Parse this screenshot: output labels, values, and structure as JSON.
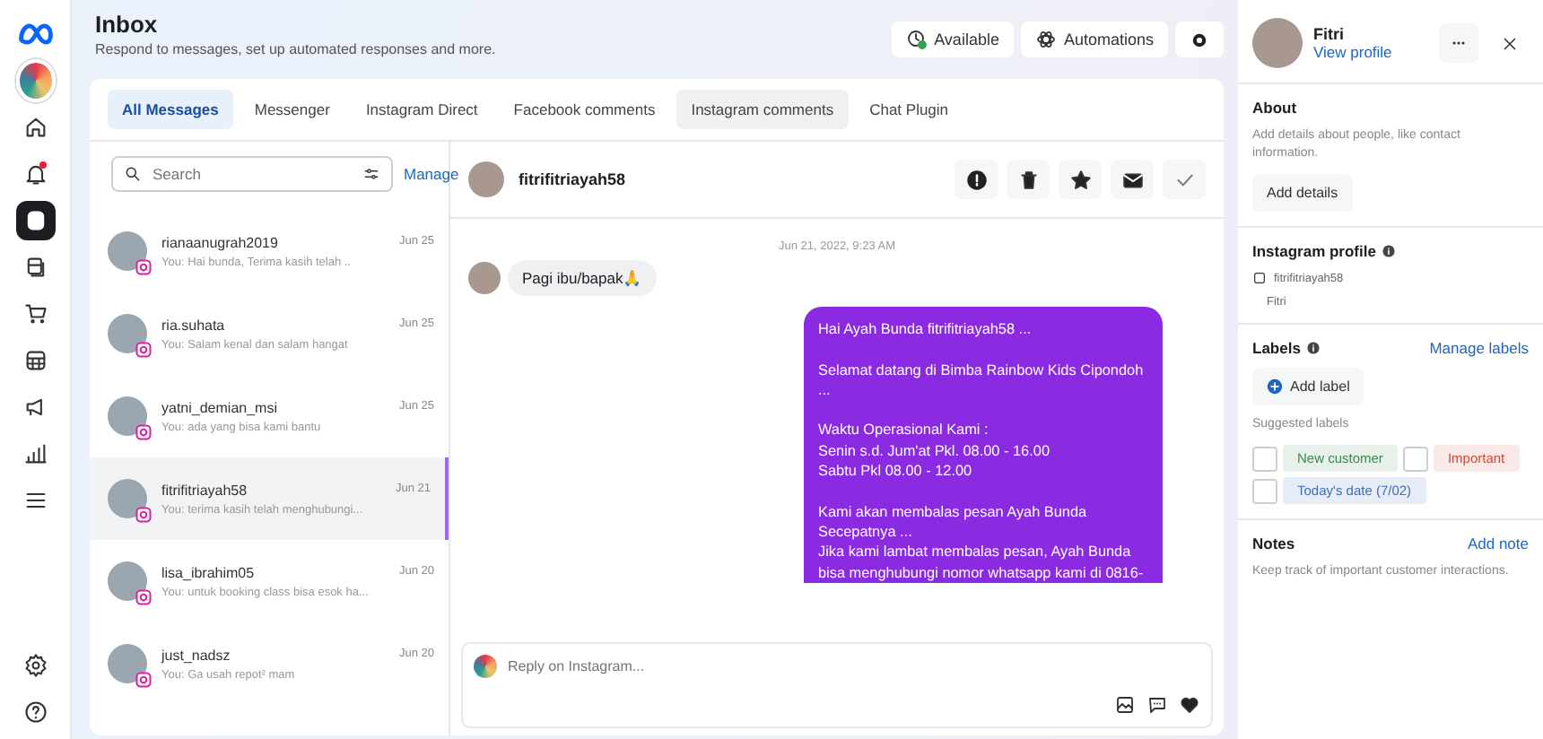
{
  "sidebar": {
    "top_items": [
      {
        "kind": "logo",
        "selected": false
      },
      {
        "kind": "page",
        "selected": false
      },
      {
        "kind": "home",
        "selected": false
      },
      {
        "kind": "bell",
        "selected": false,
        "badge": true
      },
      {
        "kind": "inbox",
        "selected": true
      },
      {
        "kind": "pages",
        "selected": false
      },
      {
        "kind": "cart",
        "selected": false
      },
      {
        "kind": "calendar",
        "selected": false
      },
      {
        "kind": "megaphone",
        "selected": false
      },
      {
        "kind": "chart",
        "selected": false
      },
      {
        "kind": "menu",
        "selected": false
      }
    ],
    "bottom_items": [
      {
        "kind": "gear",
        "selected": false
      },
      {
        "kind": "help",
        "selected": false
      }
    ]
  },
  "header": {
    "title": "Inbox",
    "subtitle": "Respond to messages, set up automated responses and more.",
    "buttons": [
      {
        "kind": "status",
        "label": "Available"
      },
      {
        "kind": "automations",
        "label": "Automations"
      },
      {
        "kind": "settings"
      }
    ]
  },
  "tabs": [
    {
      "label": "All Messages",
      "selected": true,
      "hovered": false
    },
    {
      "label": "Messenger",
      "selected": false,
      "hovered": false
    },
    {
      "label": "Instagram Direct",
      "selected": false,
      "hovered": false
    },
    {
      "label": "Facebook comments",
      "selected": false,
      "hovered": false
    },
    {
      "label": "Instagram comments",
      "selected": false,
      "hovered": true
    },
    {
      "label": "Chat Plugin",
      "selected": false,
      "hovered": false
    }
  ],
  "search": {
    "placeholder": "Search"
  },
  "manage_link": "Manage",
  "conversations": [
    {
      "name": "rianaanugrah2019",
      "preview": "You: Hai bunda, Terima kasih telah ..",
      "date": "Jun 25",
      "selected": false
    },
    {
      "name": "ria.suhata",
      "preview": "You: Salam kenal dan salam hangat",
      "date": "Jun 25",
      "selected": false
    },
    {
      "name": "yatni_demian_msi",
      "preview": "You: ada yang bisa kami bantu",
      "date": "Jun 25",
      "selected": false
    },
    {
      "name": "fitrifitriayah58",
      "preview": "You: terima kasih telah menghubungi...",
      "date": "Jun 21",
      "selected": true
    },
    {
      "name": "lisa_ibrahim05",
      "preview": "You: untuk booking class bisa esok ha...",
      "date": "Jun 20",
      "selected": false
    },
    {
      "name": "just_nadsz",
      "preview": "You: Ga usah repot² mam",
      "date": "Jun 20",
      "selected": false
    }
  ],
  "chat": {
    "contact": "fitrifitriayah58",
    "actions": [
      {
        "kind": "alert"
      },
      {
        "kind": "trash"
      },
      {
        "kind": "star"
      },
      {
        "kind": "mail"
      },
      {
        "kind": "check"
      }
    ],
    "timestamp": "Jun 21, 2022, 9:23 AM",
    "messages": [
      {
        "kind": "incoming",
        "text": "Pagi ibu/bapak🙏"
      },
      {
        "kind": "outgoing",
        "text": "Hai Ayah Bunda fitrifitriayah58  ...\n\nSelamat datang di Bimba Rainbow Kids Cipondoh\n...\n\nWaktu Operasional Kami :\nSenin s.d. Jum'at Pkl. 08.00 - 16.00\nSabtu Pkl 08.00 - 12.00\n\nKami akan membalas pesan Ayah Bunda\nSecepatnya ...\nJika kami lambat membalas pesan, Ayah Bunda\nbisa menghubungi nomor whatsapp kami di 0816-"
      }
    ],
    "reply_placeholder": "Reply on Instagram..."
  },
  "profile": {
    "name": "Fitri",
    "link": "View profile",
    "about": {
      "title": "About",
      "text": "Add details about people, like contact information.",
      "button": "Add details"
    },
    "instagram": {
      "title": "Instagram profile",
      "handle": "fitrifitriayah58",
      "name": "Fitri"
    },
    "labels": {
      "title": "Labels",
      "manage": "Manage labels",
      "add": "Add label",
      "suggested_title": "Suggested labels",
      "suggested": [
        {
          "label": "New customer",
          "color": "#3a8a4e",
          "checked": false
        },
        {
          "label": "Important",
          "color": "#d04a3a",
          "checked": false
        },
        {
          "label": "Today's date (7/02)",
          "color": "#3b6fb8",
          "checked": false
        }
      ]
    },
    "notes": {
      "title": "Notes",
      "add": "Add note",
      "text": "Keep track of important customer interactions."
    }
  }
}
